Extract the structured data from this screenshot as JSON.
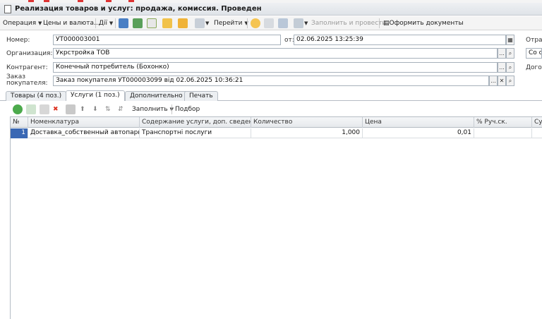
{
  "window": {
    "title": "Реализация товаров и услуг: продажа, комиссия. Проведен"
  },
  "toolbar": {
    "operation": "Операция",
    "prices": "Цены и валюта...",
    "actions": "Дії",
    "goto": "Перейти",
    "fill_and_post": "Заполнить и провести",
    "make_docs": "Оформить документы"
  },
  "header": {
    "number_label": "Номер:",
    "number_value": "УТ000003001",
    "date_label": "от:",
    "date_value": "02.06.2025 13:25:39",
    "org_label": "Организация:",
    "org_value": "Укрстройка ТОВ",
    "contractor_label": "Контрагент:",
    "contractor_value": "Конечный потребитель (Бохонко)",
    "order_label": "Заказ покупателя:",
    "order_value": "Заказ покупателя УТ000003099 від 02.06.2025 10:36:21",
    "right_label_1": "Отраз",
    "right_value_1": "Со ск",
    "right_label_2": "Догов"
  },
  "tabs": [
    {
      "label": "Товары (4 поз.)"
    },
    {
      "label": "Услуги (1 поз.)"
    },
    {
      "label": "Дополнительно"
    },
    {
      "label": "Печать"
    }
  ],
  "subtoolbar": {
    "fill": "Заполнить",
    "select": "Подбор"
  },
  "table": {
    "columns": [
      "№",
      "Номенклатура",
      "Содержание услуги, доп. сведения",
      "Количество",
      "Цена",
      "% Руч.ск.",
      "Су"
    ],
    "rows": [
      {
        "n": "1",
        "item": "Доставка_собственный автопарк",
        "content": "Транспортні послуги",
        "qty": "1,000",
        "price": "0,01",
        "disc": "",
        "sum": ""
      }
    ]
  }
}
